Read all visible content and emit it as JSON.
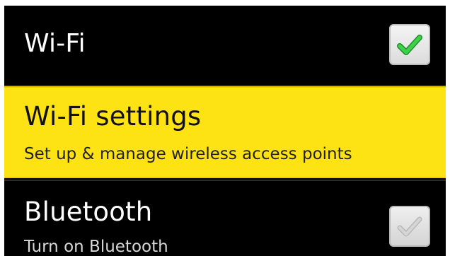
{
  "settings": {
    "items": [
      {
        "title": "Wi-Fi",
        "checked": true,
        "check_icon": "check-icon"
      },
      {
        "title": "Wi-Fi settings",
        "summary": "Set up & manage wireless access points",
        "selected": true
      },
      {
        "title": "Bluetooth",
        "summary": "Turn on Bluetooth",
        "checked": false,
        "check_icon": "check-icon"
      }
    ],
    "colors": {
      "background": "#000000",
      "selected_row": "#fde214",
      "check_active": "#2ebd3a",
      "check_inactive": "#bfbfbf"
    }
  }
}
